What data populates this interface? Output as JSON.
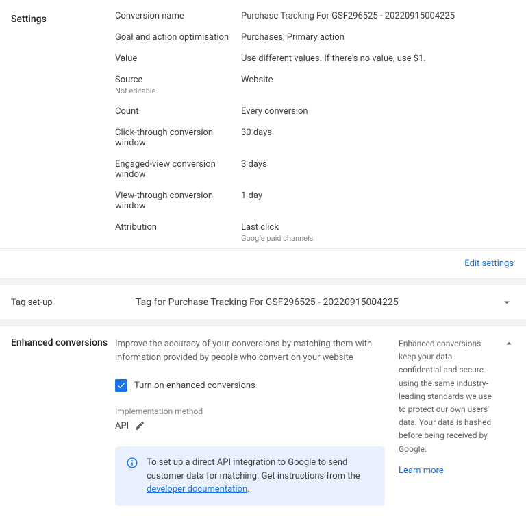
{
  "settings": {
    "title": "Settings",
    "rows": [
      {
        "label": "Conversion name",
        "sub": "",
        "value": "Purchase Tracking For GSF296525 - 20220915004225"
      },
      {
        "label": "Goal and action optimisation",
        "sub": "",
        "value": "Purchases, Primary action"
      },
      {
        "label": "Value",
        "sub": "",
        "value": "Use different values. If there's no value, use $1."
      },
      {
        "label": "Source",
        "sub": "Not editable",
        "value": "Website"
      },
      {
        "label": "Count",
        "sub": "",
        "value": "Every conversion"
      },
      {
        "label": "Click-through conversion window",
        "sub": "",
        "value": "30 days"
      },
      {
        "label": "Engaged-view conversion window",
        "sub": "",
        "value": "3 days"
      },
      {
        "label": "View-through conversion window",
        "sub": "",
        "value": "1 day"
      },
      {
        "label": "Attribution",
        "sub": "Google paid channels",
        "value": "Last click"
      }
    ],
    "edit_link": "Edit settings"
  },
  "tag": {
    "left_label": "Tag set-up",
    "title": "Tag for Purchase Tracking For GSF296525 - 20220915004225"
  },
  "enh": {
    "title": "Enhanced conversions",
    "desc": "Improve the accuracy of your conversions by matching them with information provided by people who convert on your website",
    "checkbox_label": "Turn on enhanced conversions",
    "impl_label": "Implementation method",
    "impl_value": "API",
    "info_prefix": "To set up a direct API integration to Google to send customer data for matching. Get instructions from the ",
    "info_link": "developer documentation",
    "info_suffix": ".",
    "side_text": "Enhanced conversions keep your data confidential and secure using the same industry-leading standards we use to protect our own users' data. Your data is hashed before being received by Google.",
    "learn_more": "Learn more"
  }
}
